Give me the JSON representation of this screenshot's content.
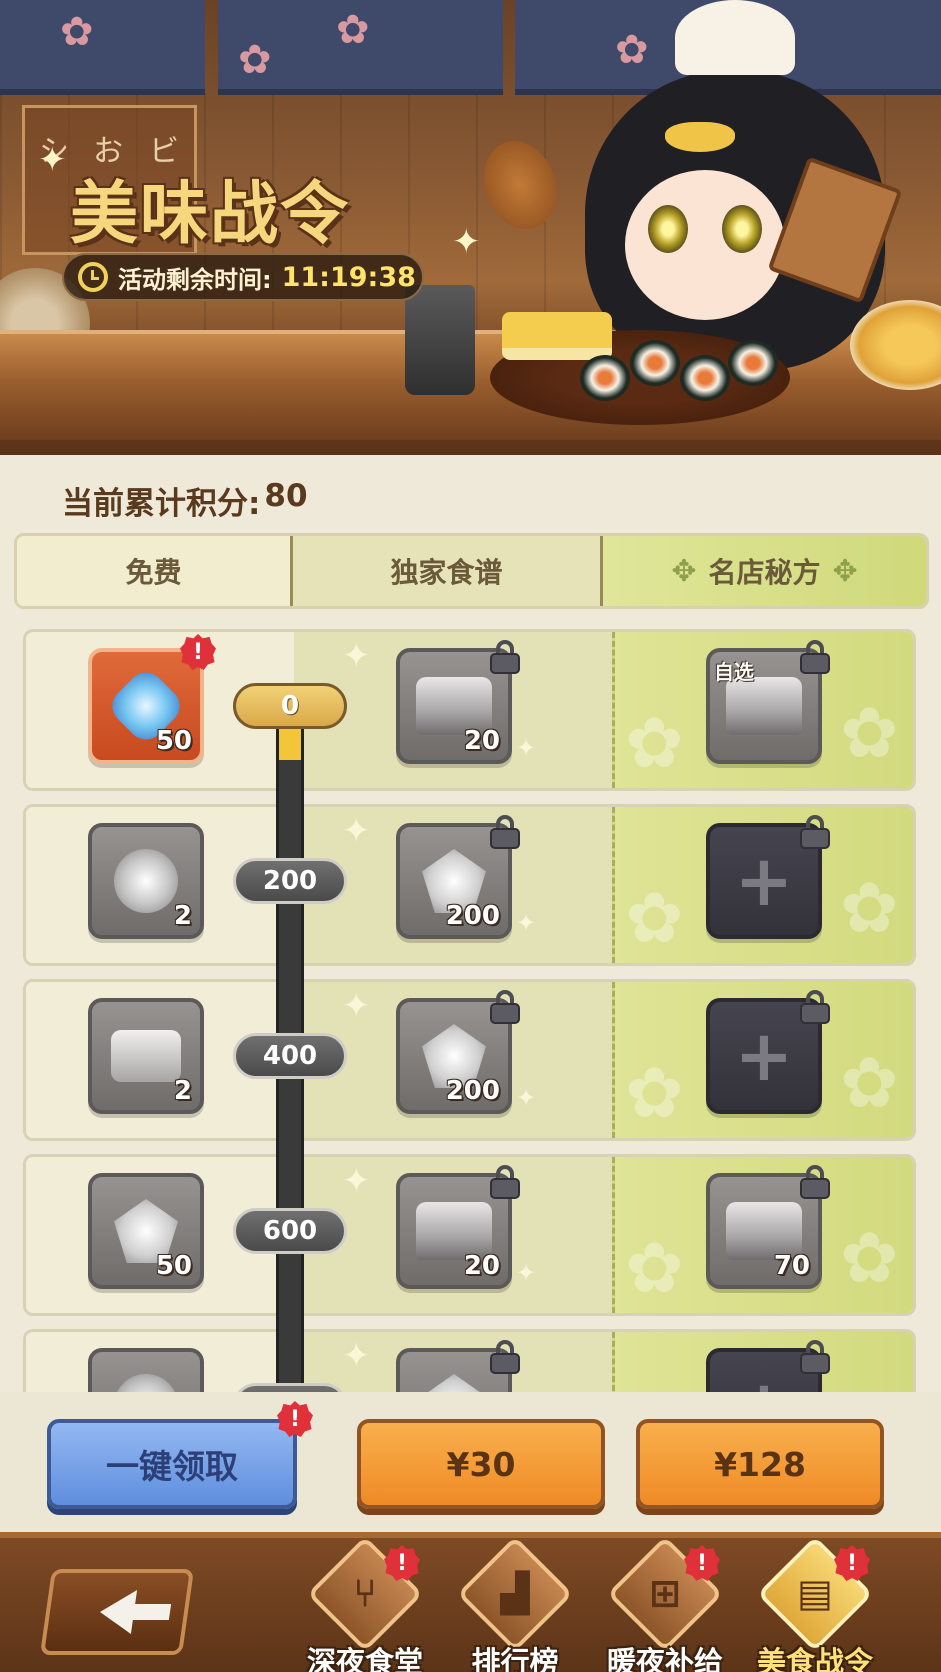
{
  "header": {
    "title": "美味战令",
    "sign_chars": [
      "シ",
      "お",
      "ビ"
    ],
    "timer_label": "活动剩余时间:",
    "timer_value": "11:19:38"
  },
  "score": {
    "label": "当前累计积分:",
    "value": "80"
  },
  "tabs": [
    {
      "label": "免费"
    },
    {
      "label": "独家食谱"
    },
    {
      "label": "名店秘方"
    }
  ],
  "rows": [
    {
      "milestone": "0",
      "free": {
        "count": "50",
        "type": "diamond",
        "alert": "!"
      },
      "exclusive": {
        "count": "20",
        "type": "chest",
        "locked": true
      },
      "premium": {
        "count": "",
        "tag": "自选",
        "type": "chest",
        "locked": true
      }
    },
    {
      "milestone": "200",
      "free": {
        "count": "2",
        "type": "helmet"
      },
      "exclusive": {
        "count": "200",
        "type": "gem",
        "locked": true
      },
      "premium": {
        "type": "empty",
        "locked": true
      }
    },
    {
      "milestone": "400",
      "free": {
        "count": "2",
        "type": "scroll"
      },
      "exclusive": {
        "count": "200",
        "type": "gem",
        "locked": true
      },
      "premium": {
        "type": "empty",
        "locked": true
      }
    },
    {
      "milestone": "600",
      "free": {
        "count": "50",
        "type": "gem"
      },
      "exclusive": {
        "count": "20",
        "type": "chest",
        "locked": true
      },
      "premium": {
        "count": "70",
        "type": "chest",
        "locked": true
      }
    }
  ],
  "progress": {
    "current": 80,
    "max_visible": 600
  },
  "buttons": {
    "claim_all": "一键领取",
    "claim_alert": "!",
    "price_exclusive": "¥30",
    "price_premium": "¥128"
  },
  "nav": {
    "items": [
      {
        "label": "深夜食堂",
        "icon": "fork-spoon-icon",
        "alert": "!"
      },
      {
        "label": "排行榜",
        "icon": "podium-icon",
        "alert": ""
      },
      {
        "label": "暖夜补给",
        "icon": "basket-icon",
        "alert": "!"
      },
      {
        "label": "美食战令",
        "icon": "notebook-icon",
        "alert": "!",
        "active": true
      }
    ]
  },
  "colors": {
    "accent_gold": "#f6d77d",
    "alert_red": "#e0303a",
    "claim_blue": "#5f8ede",
    "price_orange": "#ef8a26"
  }
}
